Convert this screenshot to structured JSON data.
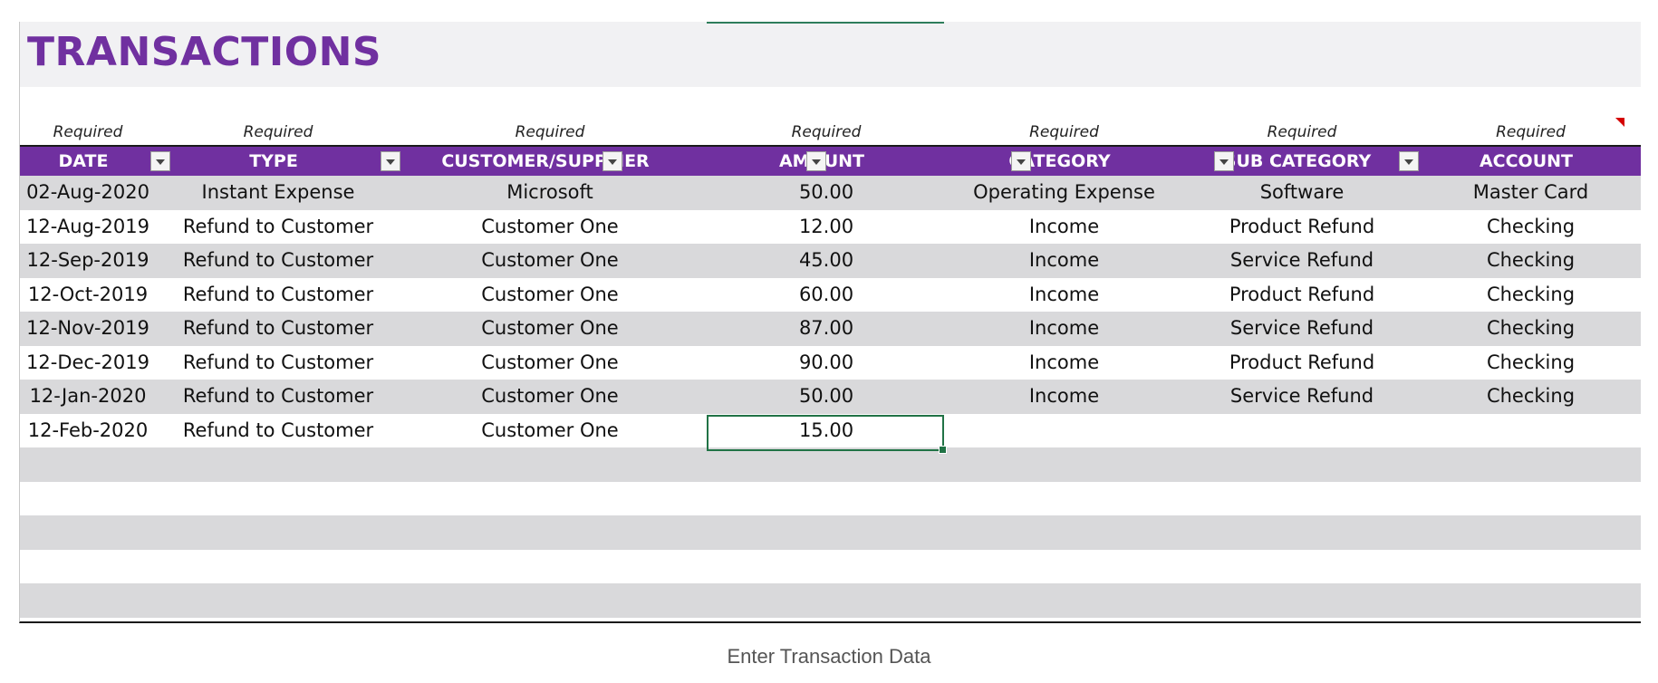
{
  "sheet": {
    "title": "TRANSACTIONS",
    "required_label": "Required",
    "columns": [
      {
        "key": "date",
        "label": "DATE"
      },
      {
        "key": "type",
        "label": "TYPE"
      },
      {
        "key": "party",
        "label": "CUSTOMER/SUPPLIER"
      },
      {
        "key": "amount",
        "label": "AMOUNT"
      },
      {
        "key": "category",
        "label": "CATEGORY"
      },
      {
        "key": "subcategory",
        "label": "SUB CATEGORY"
      },
      {
        "key": "account",
        "label": "ACCOUNT"
      }
    ],
    "rows": [
      [
        "02-Aug-2020",
        "Instant Expense",
        "Microsoft",
        "50.00",
        "Operating Expense",
        "Software",
        "Master Card"
      ],
      [
        "12-Aug-2019",
        "Refund to Customer",
        "Customer One",
        "12.00",
        "Income",
        "Product Refund",
        "Checking"
      ],
      [
        "12-Sep-2019",
        "Refund to Customer",
        "Customer One",
        "45.00",
        "Income",
        "Service Refund",
        "Checking"
      ],
      [
        "12-Oct-2019",
        "Refund to Customer",
        "Customer One",
        "60.00",
        "Income",
        "Product Refund",
        "Checking"
      ],
      [
        "12-Nov-2019",
        "Refund to Customer",
        "Customer One",
        "87.00",
        "Income",
        "Service Refund",
        "Checking"
      ],
      [
        "12-Dec-2019",
        "Refund to Customer",
        "Customer One",
        "90.00",
        "Income",
        "Product Refund",
        "Checking"
      ],
      [
        "12-Jan-2020",
        "Refund to Customer",
        "Customer One",
        "50.00",
        "Income",
        "Service Refund",
        "Checking"
      ],
      [
        "12-Feb-2020",
        "Refund to Customer",
        "Customer One",
        "15.00",
        "",
        "",
        ""
      ],
      [
        "",
        "",
        "",
        "",
        "",
        "",
        ""
      ],
      [
        "",
        "",
        "",
        "",
        "",
        "",
        ""
      ],
      [
        "",
        "",
        "",
        "",
        "",
        "",
        ""
      ],
      [
        "",
        "",
        "",
        "",
        "",
        "",
        ""
      ],
      [
        "",
        "",
        "",
        "",
        "",
        "",
        ""
      ]
    ]
  },
  "caption": "Enter Transaction Data",
  "colors": {
    "title": "#7030a0",
    "header_bg": "#7030a0",
    "band": "#d9d9db",
    "selection": "#217346"
  }
}
